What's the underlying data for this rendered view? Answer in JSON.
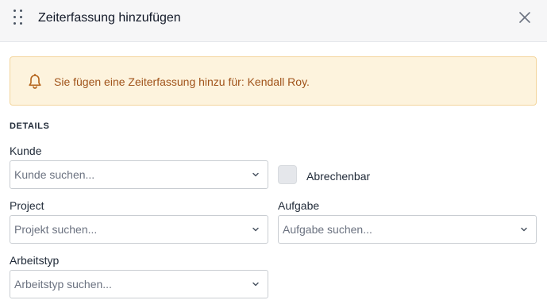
{
  "header": {
    "title": "Zeiterfassung hinzufügen",
    "drag_icon": "drag-handle-icon",
    "close_icon": "close-icon"
  },
  "notice": {
    "icon": "bell-icon",
    "text": "Sie fügen eine Zeiterfassung hinzu für: Kendall Roy.",
    "colors": {
      "background": "#fdf3dd",
      "border": "#f3d59c",
      "text": "#a0531a"
    }
  },
  "details": {
    "section_title": "DETAILS",
    "customer": {
      "label": "Kunde",
      "placeholder": "Kunde suchen..."
    },
    "billable": {
      "label": "Abrechenbar",
      "checked": false
    },
    "project": {
      "label": "Project",
      "placeholder": "Projekt suchen..."
    },
    "task": {
      "label": "Aufgabe",
      "placeholder": "Aufgabe suchen..."
    },
    "work_type": {
      "label": "Arbeitstyp",
      "placeholder": "Arbeitstyp suchen..."
    }
  }
}
